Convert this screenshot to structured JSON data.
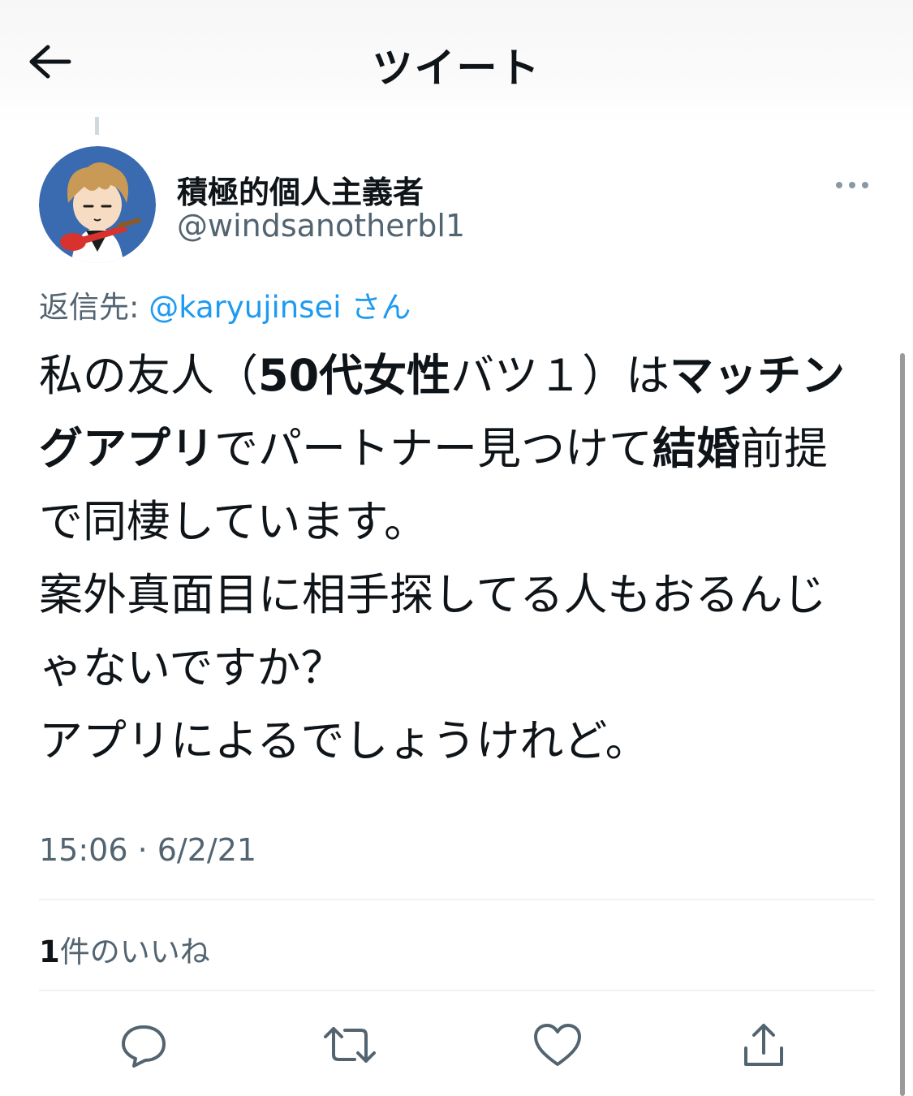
{
  "header": {
    "title": "ツイート",
    "back_icon": "arrow-left-icon"
  },
  "author": {
    "display_name": "積極的個人主義者",
    "handle": "@windsanotherbl1",
    "avatar_bg": "#3a6ab0"
  },
  "reply_context": {
    "prefix": "返信先: ",
    "mention": "@karyujinsei",
    "suffix": " さん"
  },
  "tweet": {
    "segments": [
      {
        "text": "私の友人（",
        "bold": false
      },
      {
        "text": "50代女性",
        "bold": true
      },
      {
        "text": "バツ１）は",
        "bold": false
      },
      {
        "text": "マッチングアプリ",
        "bold": true
      },
      {
        "text": "でパートナー見つけて",
        "bold": false
      },
      {
        "text": "結婚",
        "bold": true
      },
      {
        "text": "前提で同棲しています。",
        "bold": false
      },
      {
        "text": "\n案外真面目に相手探してる人もおるんじゃないですか？",
        "bold": false
      },
      {
        "text": "\nアプリによるでしょうけれど。",
        "bold": false
      }
    ],
    "timestamp": "15:06 · 6/2/21"
  },
  "stats": {
    "like_count": "1",
    "like_label": "件のいいね"
  },
  "actions": [
    {
      "name": "reply-icon"
    },
    {
      "name": "retweet-icon"
    },
    {
      "name": "like-icon"
    },
    {
      "name": "share-icon"
    }
  ],
  "colors": {
    "accent": "#1d9bf0",
    "secondary_text": "#536471",
    "text": "#0f1419"
  }
}
